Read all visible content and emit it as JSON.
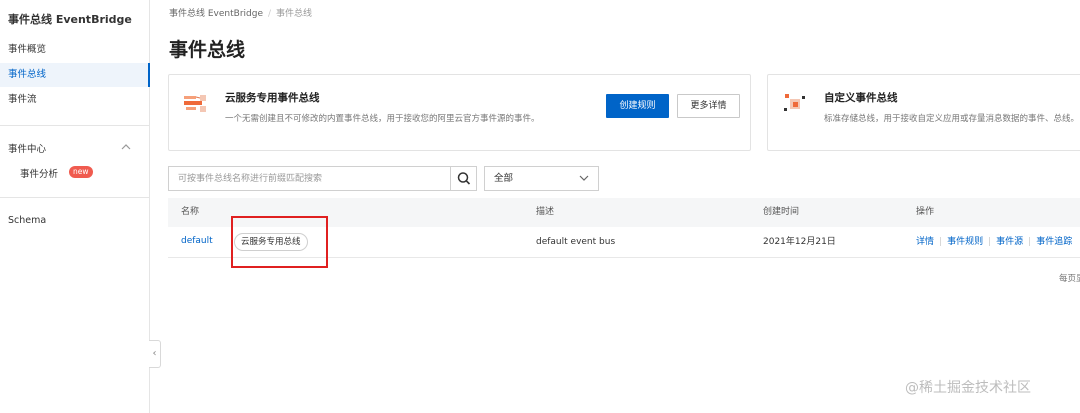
{
  "sidebar": {
    "brand": "事件总线 EventBridge",
    "items": [
      {
        "label": "事件概览"
      },
      {
        "label": "事件总线"
      },
      {
        "label": "事件流"
      }
    ],
    "group": {
      "label": "事件中心",
      "sub_label": "事件分析",
      "badge": "new"
    },
    "schema_label": "Schema",
    "collapse_icon": "‹"
  },
  "breadcrumb": {
    "root": "事件总线 EventBridge",
    "separator": "/",
    "current": "事件总线"
  },
  "page_title": "事件总线",
  "cards": {
    "cloud": {
      "title": "云服务专用事件总线",
      "desc": "一个无需创建且不可修改的内置事件总线，用于接收您的阿里云官方事件源的事件。",
      "primary_button": "创建规则",
      "secondary_button": "更多详情"
    },
    "custom": {
      "title": "自定义事件总线",
      "desc": "标准存储总线，用于接收自定义应用或存量消息数据的事件、总线。"
    }
  },
  "search": {
    "placeholder": "可按事件总线名称进行前缀匹配搜索",
    "icon": "search-icon"
  },
  "filter": {
    "selected": "全部"
  },
  "table": {
    "headers": [
      "名称",
      "描述",
      "创建时间",
      "操作"
    ],
    "rows": [
      {
        "name": "default",
        "tag": "云服务专用总线",
        "desc": "default event bus",
        "created": "2021年12月21日",
        "actions": [
          "详情",
          "事件规则",
          "事件源",
          "事件追踪"
        ]
      }
    ]
  },
  "pager_text": "每页显",
  "watermark": "@稀土掘金技术社区",
  "colors": {
    "accent": "#0064c8",
    "badge": "#f05b4f",
    "highlight_box": "#e02020"
  }
}
